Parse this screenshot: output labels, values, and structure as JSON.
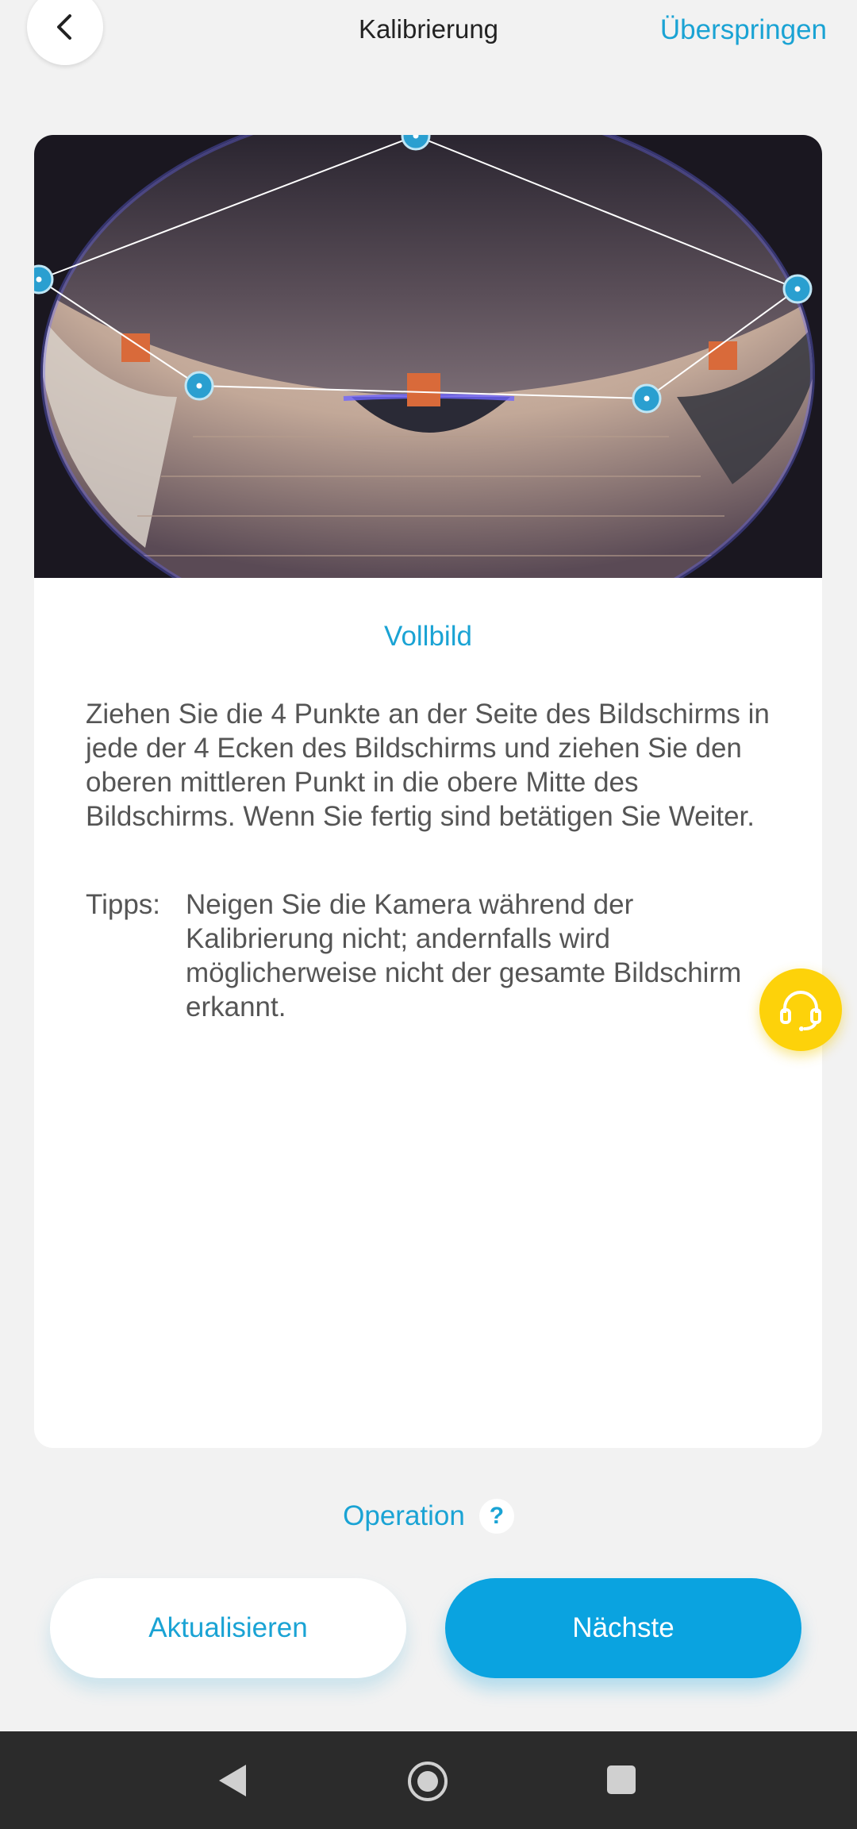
{
  "header": {
    "title": "Kalibrierung",
    "skip_label": "Überspringen"
  },
  "calibration": {
    "subtitle": "Vollbild",
    "description": "Ziehen Sie die 4 Punkte an der Seite des Bildschirms in jede der 4 Ecken des Bildschirms und ziehen Sie den oberen mittleren Punkt in die obere Mitte des Bildschirms. Wenn Sie fertig sind betätigen Sie Weiter.",
    "tips_label": "Tipps:",
    "tips_text": "Neigen Sie die Kamera während der Kalibrierung nicht; andernfalls wird möglicherweise nicht der gesamte Bildschirm erkannt."
  },
  "operation": {
    "label": "Operation",
    "help_icon": "question-icon"
  },
  "buttons": {
    "refresh_label": "Aktualisieren",
    "next_label": "Nächste"
  },
  "icons": {
    "back": "chevron-left-icon",
    "support": "headset-icon",
    "nav_back": "triangle-back-icon",
    "nav_home": "circle-home-icon",
    "nav_recent": "square-recent-icon"
  },
  "colors": {
    "accent": "#1aa3d4",
    "primary_button": "#0aa3e0",
    "support_button": "#fdd20a",
    "calibration_point": "#2a9fd0"
  }
}
